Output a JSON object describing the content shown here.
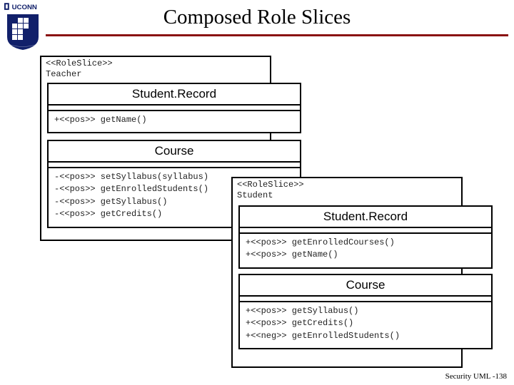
{
  "header": {
    "brand": "UCONN",
    "title": "Composed Role Slices"
  },
  "footer": {
    "text": "Security UML -138"
  },
  "teacher": {
    "stereo": "<<RoleSlice>>",
    "name": "Teacher",
    "studentRecord": {
      "className": "Student.Record",
      "ops": {
        "r0": "+<<pos>> getName()"
      }
    },
    "course": {
      "className": "Course",
      "ops": {
        "r0": "-<<pos>> setSyllabus(syllabus)",
        "r1": "-<<pos>> getEnrolledStudents()",
        "r2": "-<<pos>> getSyllabus()",
        "r3": "-<<pos>> getCredits()"
      }
    }
  },
  "student": {
    "stereo": "<<RoleSlice>>",
    "name": "Student",
    "studentRecord": {
      "className": "Student.Record",
      "ops": {
        "r0": "+<<pos>> getEnrolledCourses()",
        "r1": "+<<pos>> getName()"
      }
    },
    "course": {
      "className": "Course",
      "ops": {
        "r0": "+<<pos>> getSyllabus()",
        "r1": "+<<pos>> getCredits()",
        "r2": "+<<neg>> getEnrolledStudents()"
      }
    }
  }
}
